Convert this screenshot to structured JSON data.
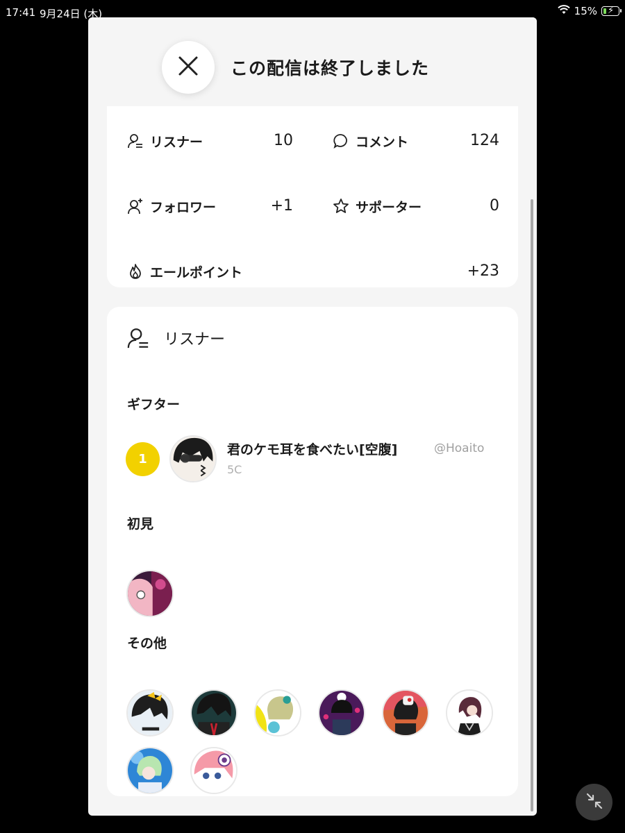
{
  "status_bar": {
    "time": "17:41",
    "date": "9月24日 (木)",
    "battery": "15%"
  },
  "header": {
    "title": "この配信は終了しました"
  },
  "stats": {
    "listeners": {
      "label": "リスナー",
      "value": "10",
      "icon": "listener-icon"
    },
    "comments": {
      "label": "コメント",
      "value": "124",
      "icon": "comment-icon"
    },
    "followers": {
      "label": "フォロワー",
      "value": "+1",
      "icon": "add-user-icon"
    },
    "supporters": {
      "label": "サポーター",
      "value": "0",
      "icon": "star-icon"
    },
    "yell_points": {
      "label": "エールポイント",
      "value": "+23",
      "icon": "flame-icon"
    }
  },
  "listener_section": {
    "title": "リスナー",
    "gifter_label": "ギフター",
    "gifters": [
      {
        "rank": "1",
        "name": "君のケモ耳を食べたい[空腹]",
        "handle": "@Hoaito",
        "sub": "5C"
      }
    ],
    "first_time_label": "初見",
    "others_label": "その他"
  },
  "colors": {
    "rank_badge": "#f2d100",
    "card": "#ffffff",
    "sheet": "#f5f5f5"
  }
}
